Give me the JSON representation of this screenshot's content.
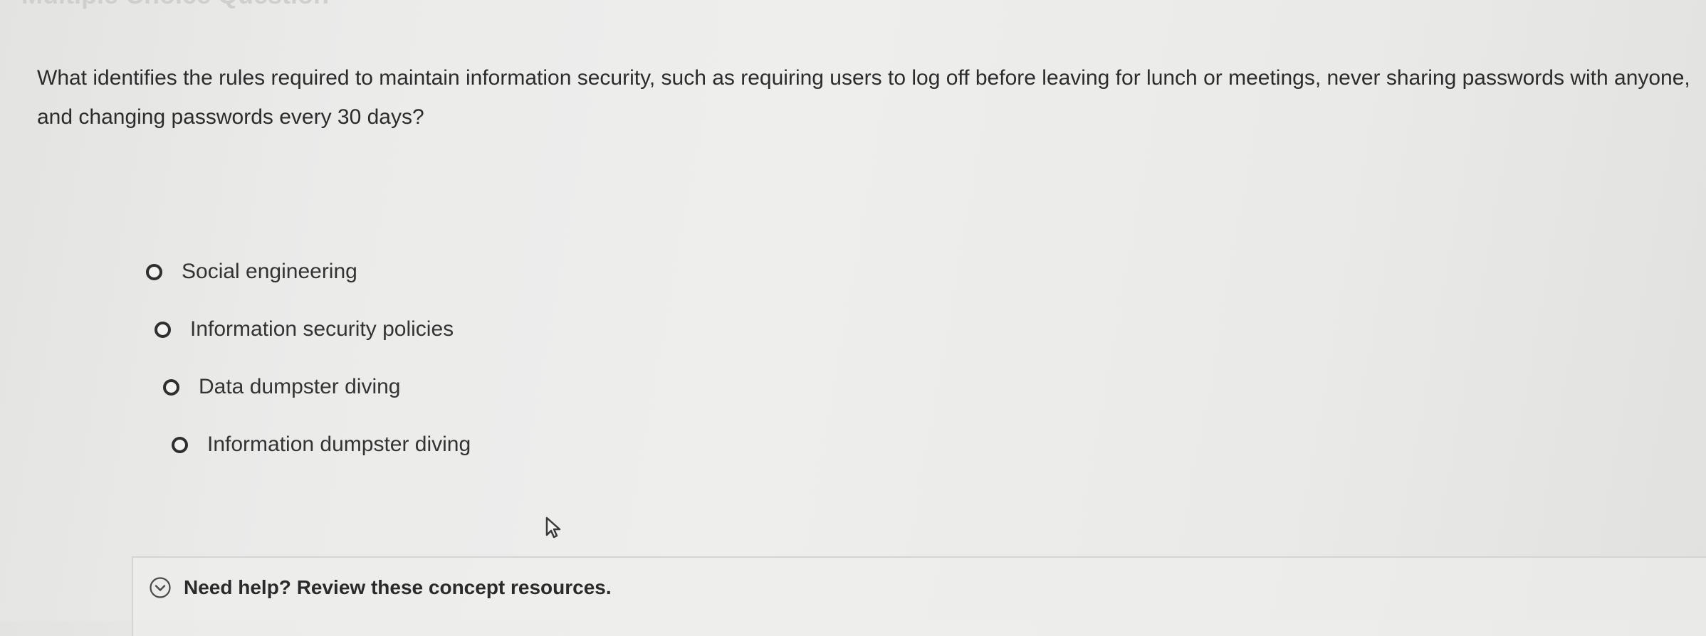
{
  "page": {
    "heading": "Multiple Choice Question"
  },
  "question": {
    "text": "What identifies the rules required to maintain information security, such as requiring users to log off before leaving for lunch or meetings, never sharing passwords with anyone, and changing passwords every 30 days?"
  },
  "options": [
    {
      "label": "Social engineering",
      "selected": false
    },
    {
      "label": "Information security policies",
      "selected": false
    },
    {
      "label": "Data dumpster diving",
      "selected": false
    },
    {
      "label": "Information dumpster diving",
      "selected": false
    }
  ],
  "help": {
    "label": "Need help? Review these concept resources.",
    "icon": "chevron-down-circle-icon"
  },
  "cursor": {
    "icon": "mouse-pointer-icon"
  },
  "colors": {
    "text": "#2c2c2c",
    "radio_border": "#2f2f2f",
    "background": "#ebebea"
  }
}
